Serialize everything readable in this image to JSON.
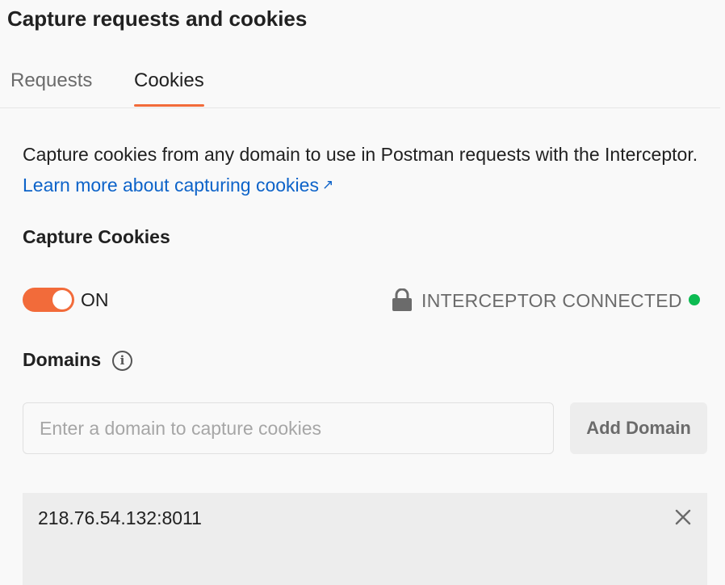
{
  "header": {
    "title": "Capture requests and cookies"
  },
  "tabs": [
    {
      "label": "Requests",
      "active": false
    },
    {
      "label": "Cookies",
      "active": true
    }
  ],
  "description": {
    "text": "Capture cookies from any domain to use in Postman requests with the Interceptor.",
    "link": "Learn more about capturing cookies"
  },
  "capture": {
    "label": "Capture Cookies",
    "toggle_state": "ON",
    "status_text": "INTERCEPTOR CONNECTED"
  },
  "domains": {
    "label": "Domains",
    "input_placeholder": "Enter a domain to capture cookies",
    "input_value": "",
    "add_button": "Add Domain",
    "items": [
      {
        "value": "218.76.54.132:8011"
      }
    ]
  },
  "colors": {
    "accent": "#f26b3a",
    "link": "#0d63c9",
    "status_connected": "#0cbb52"
  },
  "icons": [
    "external-link-icon",
    "lock-icon",
    "info-icon",
    "close-icon"
  ]
}
